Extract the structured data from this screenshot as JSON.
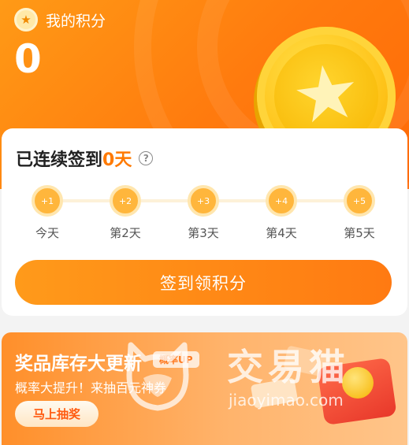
{
  "header": {
    "title": "我的积分",
    "points": "0",
    "icons": {
      "title": "star-coin-icon",
      "coin": "star-coin-illustration"
    }
  },
  "signin": {
    "streak_prefix": "已连续签到",
    "streak_count": "0天",
    "help_icon": "?",
    "days": [
      {
        "bonus": "+1",
        "label": "今天"
      },
      {
        "bonus": "+2",
        "label": "第2天"
      },
      {
        "bonus": "+3",
        "label": "第3天"
      },
      {
        "bonus": "+4",
        "label": "第4天"
      },
      {
        "bonus": "+5",
        "label": "第5天"
      }
    ],
    "button_label": "签到领积分"
  },
  "banner": {
    "title": "奖品库存大更新",
    "tag": "概率UP",
    "subtitle": "概率大提升！来抽百元神券",
    "button_label": "马上抽奖"
  },
  "watermark": {
    "text": "交易猫",
    "url": "jiaoyimao.com"
  },
  "colors": {
    "accent": "#ff7a00",
    "header_gradient_start": "#ff9a16",
    "header_gradient_end": "#ff6a07",
    "coin": "#ffc51c"
  }
}
